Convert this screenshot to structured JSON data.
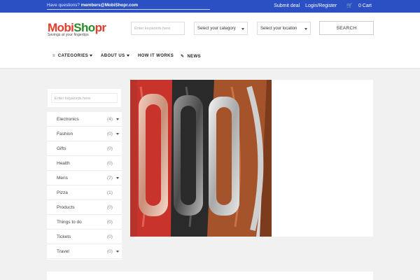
{
  "topbar": {
    "question_prefix": "Have questions? ",
    "email": "members@MobiShopr.com",
    "submit_deal": "Submit deal",
    "login_register": "Login/Register",
    "cart": "0 Cart"
  },
  "logo": {
    "part1": "Mobi",
    "part2": "Sho",
    "part3": "pr",
    "tagline": "Savings at your fingertips"
  },
  "header": {
    "search_placeholder": "Enter keywords here",
    "category_select": "Select your category",
    "location_select": "Select your location",
    "search_button": "SEARCH"
  },
  "nav": {
    "categories": "CATEGORIES",
    "about": "ABOUT US",
    "how": "HOW IT WORKS",
    "news": "NEWS"
  },
  "sidebar": {
    "search_placeholder": "Enter keywords here",
    "categories": [
      {
        "name": "Electronics",
        "count": "(4)"
      },
      {
        "name": "Fashion",
        "count": "(0)"
      },
      {
        "name": "Gifts",
        "count": "(0)"
      },
      {
        "name": "Health",
        "count": "(0)"
      },
      {
        "name": "Mens",
        "count": "(7)"
      },
      {
        "name": "Pizza",
        "count": "(1)"
      },
      {
        "name": "Products",
        "count": "(0)"
      },
      {
        "name": "Things to do",
        "count": "(0)"
      },
      {
        "name": "Tickets",
        "count": "(0)"
      },
      {
        "name": "Travel",
        "count": "(0)"
      }
    ]
  },
  "colors": {
    "topbar": "#2a50c4",
    "band_red": "#c8332b",
    "band_black": "#2a2a2a",
    "band_brown": "#a4532a"
  }
}
